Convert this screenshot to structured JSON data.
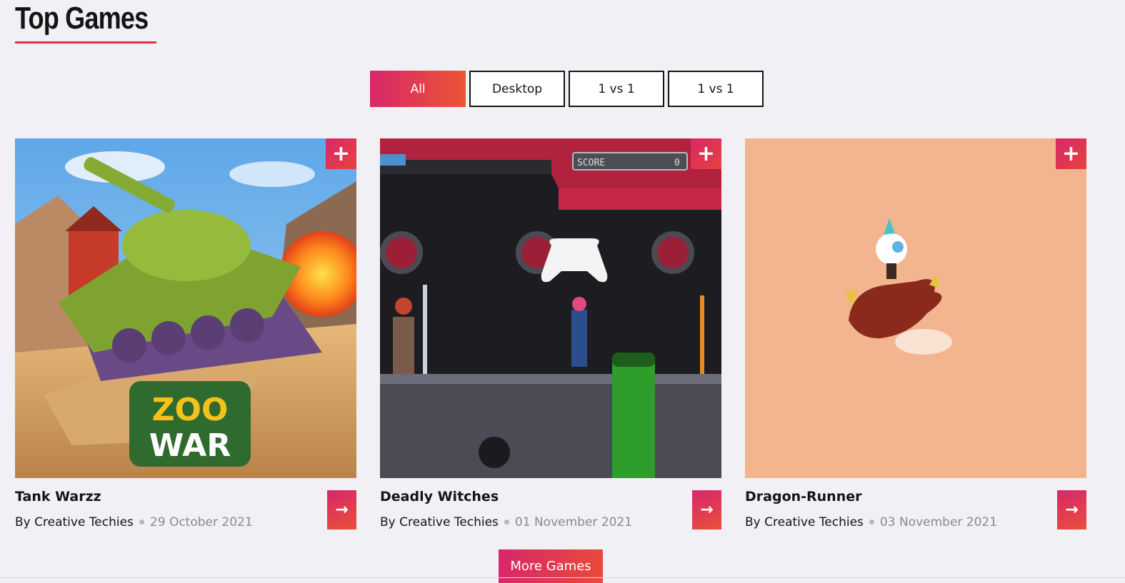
{
  "section": {
    "title": "Top Games"
  },
  "filters": [
    {
      "label": "All",
      "active": true
    },
    {
      "label": "Desktop",
      "active": false
    },
    {
      "label": "1 vs 1",
      "active": false
    },
    {
      "label": "1 vs 1",
      "active": false
    }
  ],
  "games": [
    {
      "title": "Tank Warzz",
      "author": "By Creative Techies",
      "date": "29 October 2021",
      "logo_text_1": "ZOO",
      "logo_text_2": "WAR"
    },
    {
      "title": "Deadly Witches",
      "author": "By Creative Techies",
      "date": "01 November 2021",
      "hud_label": "SCORE",
      "hud_value": "0"
    },
    {
      "title": "Dragon-Runner",
      "author": "By Creative Techies",
      "date": "03 November 2021"
    }
  ],
  "icons": {
    "plus": "plus-icon",
    "arrow": "arrow-right-icon"
  },
  "more_button": {
    "label": "More Games"
  },
  "colors": {
    "accent": "#d8276a",
    "accent_end": "#ea5534",
    "underline": "#e0323f",
    "background": "#f1f1f5"
  }
}
